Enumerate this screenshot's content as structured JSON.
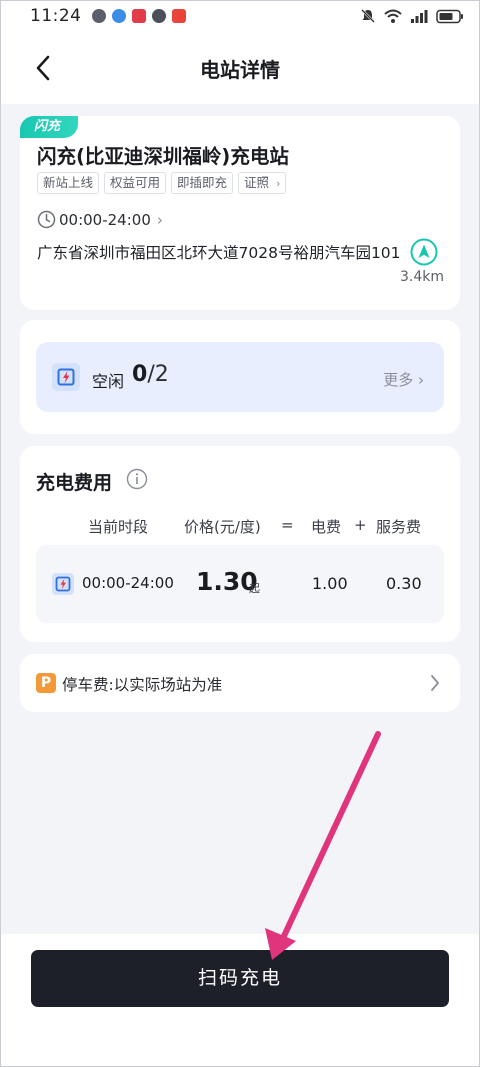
{
  "status_bar": {
    "time": "11:24",
    "notification_icons": [
      "chat-bubble-icon",
      "browser-globe-icon",
      "badge-app-icon",
      "wechat-icon",
      "red-app-icon"
    ],
    "right_icons": [
      "mute-bell-icon",
      "wifi-icon",
      "network-4g-icon",
      "signal-icon",
      "battery-icon"
    ]
  },
  "header": {
    "title": "电站详情"
  },
  "station": {
    "badge": "闪充",
    "name": "闪充(比亚迪深圳福岭)充电站",
    "tags": [
      "新站上线",
      "权益可用",
      "即插即充",
      "证照"
    ],
    "hours": "00:00-24:00",
    "address": "广东省深圳市福田区北环大道7028号裕朋汽车园101",
    "distance": "3.4km"
  },
  "availability": {
    "label": "空闲",
    "available": "0",
    "total": "2",
    "more": "更多"
  },
  "fee": {
    "title": "充电费用",
    "headers": {
      "period": "当前时段",
      "price": "价格(元/度)",
      "equals": "=",
      "electricity": "电费",
      "plus": "+",
      "service": "服务费"
    },
    "rows": [
      {
        "period": "00:00-24:00",
        "price": "1.30",
        "price_suffix": "起",
        "electricity": "1.00",
        "service": "0.30"
      }
    ]
  },
  "parking": {
    "icon_letter": "P",
    "text": "停车费:以实际场站为准"
  },
  "action": {
    "scan_label": "扫码充电"
  },
  "colors": {
    "accent_teal": "#18c7b0",
    "availability_bg": "#e8eefd",
    "parking_orange": "#f29a3a",
    "button_dark": "#1d2029",
    "annotation_arrow": "#e0357d"
  }
}
